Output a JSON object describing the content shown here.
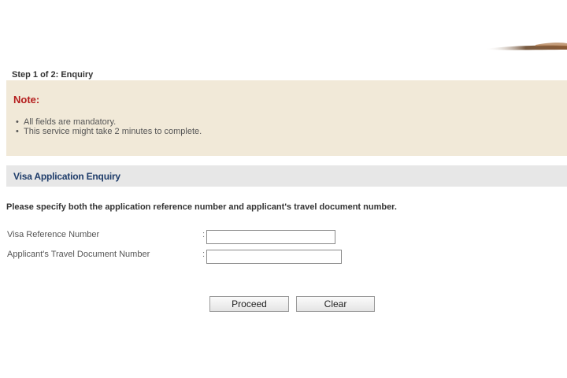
{
  "step_label": "Step 1 of 2: Enquiry",
  "note": {
    "title": "Note:",
    "items": [
      "All fields are mandatory.",
      "This service might take 2 minutes to complete."
    ]
  },
  "section": {
    "title": "Visa Application Enquiry"
  },
  "instruction": "Please specify both the application reference number and applicant's travel document number.",
  "form": {
    "fields": [
      {
        "label": "Visa Reference Number",
        "separator": ":",
        "value": "",
        "placeholder": ""
      },
      {
        "label": "Applicant's Travel Document Number",
        "separator": ":",
        "value": "",
        "placeholder": ""
      }
    ]
  },
  "buttons": {
    "proceed": "Proceed",
    "clear": "Clear"
  },
  "colors": {
    "note_background": "#f1e9d8",
    "note_title": "#b41d1d",
    "section_background": "#e7e7e7",
    "section_title": "#1f3d6b"
  }
}
